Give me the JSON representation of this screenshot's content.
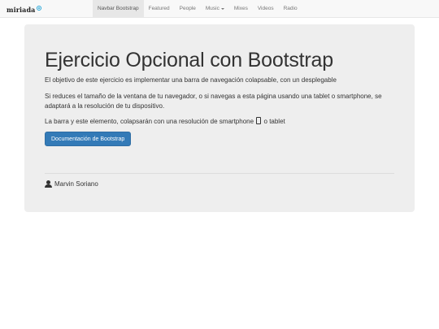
{
  "navbar": {
    "brand": "miriada",
    "items": [
      {
        "label": "Navbar Bootstrap",
        "active": true
      },
      {
        "label": "Featured"
      },
      {
        "label": "People"
      },
      {
        "label": "Music",
        "dropdown": true
      },
      {
        "label": "Mixes"
      },
      {
        "label": "Videos"
      },
      {
        "label": "Radio"
      }
    ]
  },
  "jumbotron": {
    "title": "Ejercicio Opcional con Bootstrap",
    "paragraph1": "El objetivo de este ejercicio es implementar una barra de navegación colapsable, con un desplegable",
    "paragraph2": "Si reduces el tamaño de la ventana de tu navegador, o si navegas a esta página usando una tablet o smartphone, se adaptará a la resolución de tu dispositivo.",
    "paragraph3_before": "La barra y este elemento, colapsarán con una resolución de smartphone",
    "paragraph3_after": "o tablet",
    "button_label": "Documentación de Bootstrap",
    "author": "Marvin Soriano"
  },
  "icons": {
    "brand": "circle-logo-icon",
    "phone": "phone-icon",
    "user": "user-icon",
    "music_dropdown": "caret-down-icon"
  },
  "colors": {
    "navbar_bg": "#f8f8f8",
    "jumbotron_bg": "#eeeeee",
    "button_bg": "#337ab7",
    "brand_accent": "#25a6d8"
  }
}
